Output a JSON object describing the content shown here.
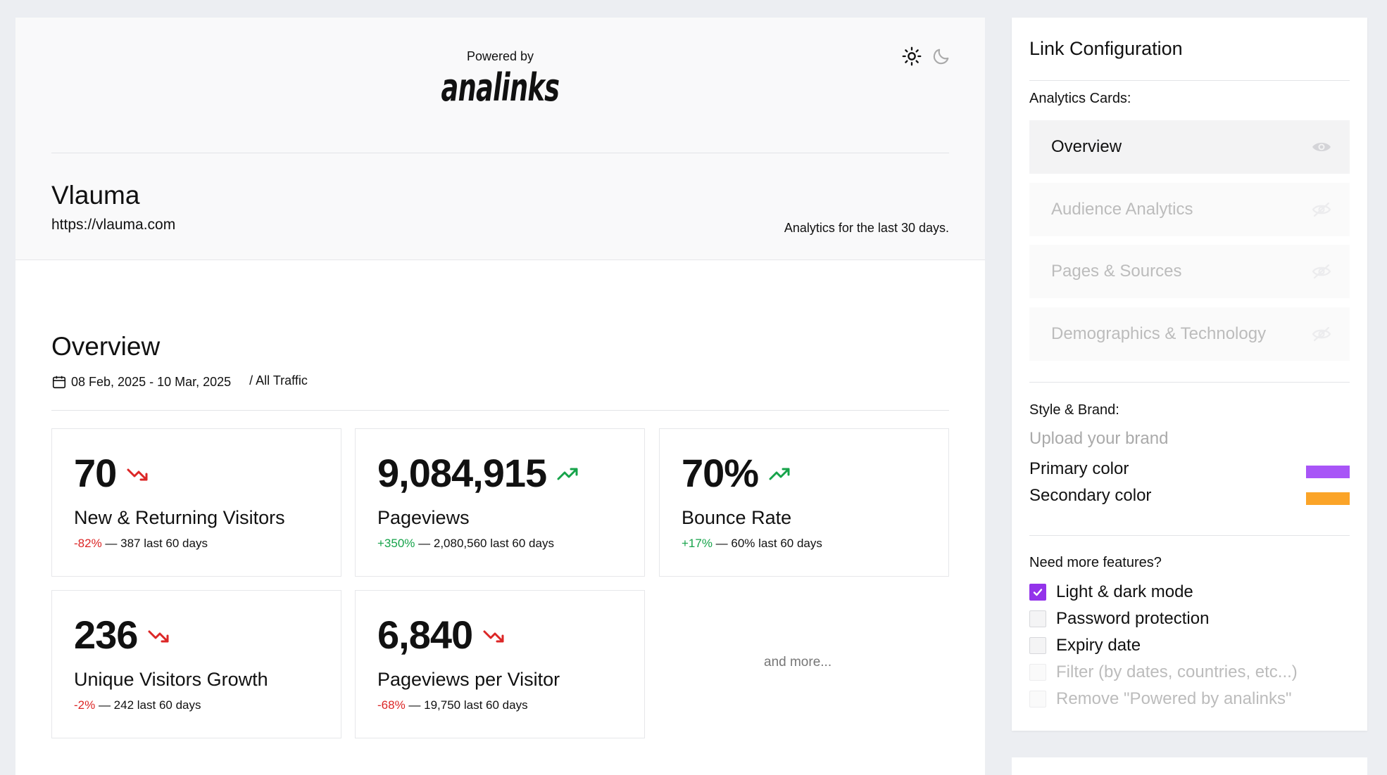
{
  "preview": {
    "powered_by": "Powered by",
    "brand_logo_text": "analinks",
    "theme": {
      "light_icon": "sun-icon",
      "dark_icon": "moon-icon"
    },
    "site_name": "Vlauma",
    "site_url": "https://vlauma.com",
    "analytics_range": "Analytics for the last 30 days."
  },
  "overview": {
    "title": "Overview",
    "date_range": "08 Feb, 2025 - 10 Mar, 2025",
    "traffic_filter": "/ All Traffic",
    "cards": [
      {
        "value": "70",
        "trend": "down",
        "label": "New & Returning Visitors",
        "change": "-82%",
        "rest": " — 387 last 60 days"
      },
      {
        "value": "9,084,915",
        "trend": "up",
        "label": "Pageviews",
        "change": "+350%",
        "rest": " — 2,080,560 last 60 days"
      },
      {
        "value": "70%",
        "trend": "up",
        "label": "Bounce Rate",
        "change": "+17%",
        "rest": " — 60% last 60 days"
      },
      {
        "value": "236",
        "trend": "down",
        "label": "Unique Visitors Growth",
        "change": "-2%",
        "rest": " — 242 last 60 days"
      },
      {
        "value": "6,840",
        "trend": "down",
        "label": "Pageviews per Visitor",
        "change": "-68%",
        "rest": " — 19,750 last 60 days"
      }
    ],
    "and_more": "and more..."
  },
  "config": {
    "title": "Link Configuration",
    "analytics_cards_label": "Analytics Cards:",
    "analytics_cards": [
      {
        "label": "Overview",
        "visible": true
      },
      {
        "label": "Audience Analytics",
        "visible": false
      },
      {
        "label": "Pages & Sources",
        "visible": false
      },
      {
        "label": "Demographics & Technology",
        "visible": false
      }
    ],
    "style_label": "Style & Brand:",
    "upload_brand": "Upload your brand",
    "primary_color_label": "Primary color",
    "primary_color": "#a855f7",
    "secondary_color_label": "Secondary color",
    "secondary_color": "#fba428",
    "features_label": "Need more features?",
    "features": [
      {
        "label": "Light & dark mode",
        "checked": true,
        "enabled": true
      },
      {
        "label": "Password protection",
        "checked": false,
        "enabled": true
      },
      {
        "label": "Expiry date",
        "checked": false,
        "enabled": true
      },
      {
        "label": "Filter (by dates, countries, etc...)",
        "checked": false,
        "enabled": false
      },
      {
        "label": "Remove \"Powered by analinks\"",
        "checked": false,
        "enabled": false
      }
    ]
  },
  "colors": {
    "positive": "#16a34a",
    "negative": "#dc2626",
    "accent": "#9333ea"
  }
}
